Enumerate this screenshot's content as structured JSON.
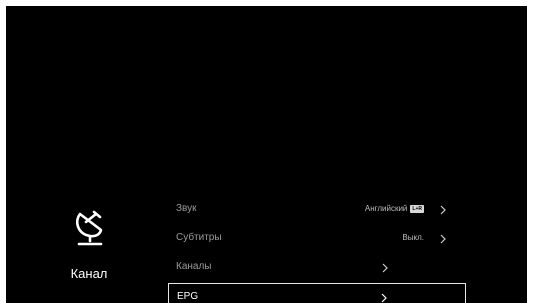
{
  "side": {
    "icon": "satellite-dish-icon",
    "label": "Канал"
  },
  "menu": {
    "items": [
      {
        "label": "Звук",
        "value": "Английский",
        "badge": "L+R"
      },
      {
        "label": "Субтитры",
        "value": "Выкл."
      },
      {
        "label": "Каналы"
      },
      {
        "label": "EPG"
      }
    ]
  },
  "colors": {
    "background": "#000000",
    "frame": "#ffffff",
    "text_dim": "#9a9a9a",
    "text_focus": "#ffffff"
  }
}
